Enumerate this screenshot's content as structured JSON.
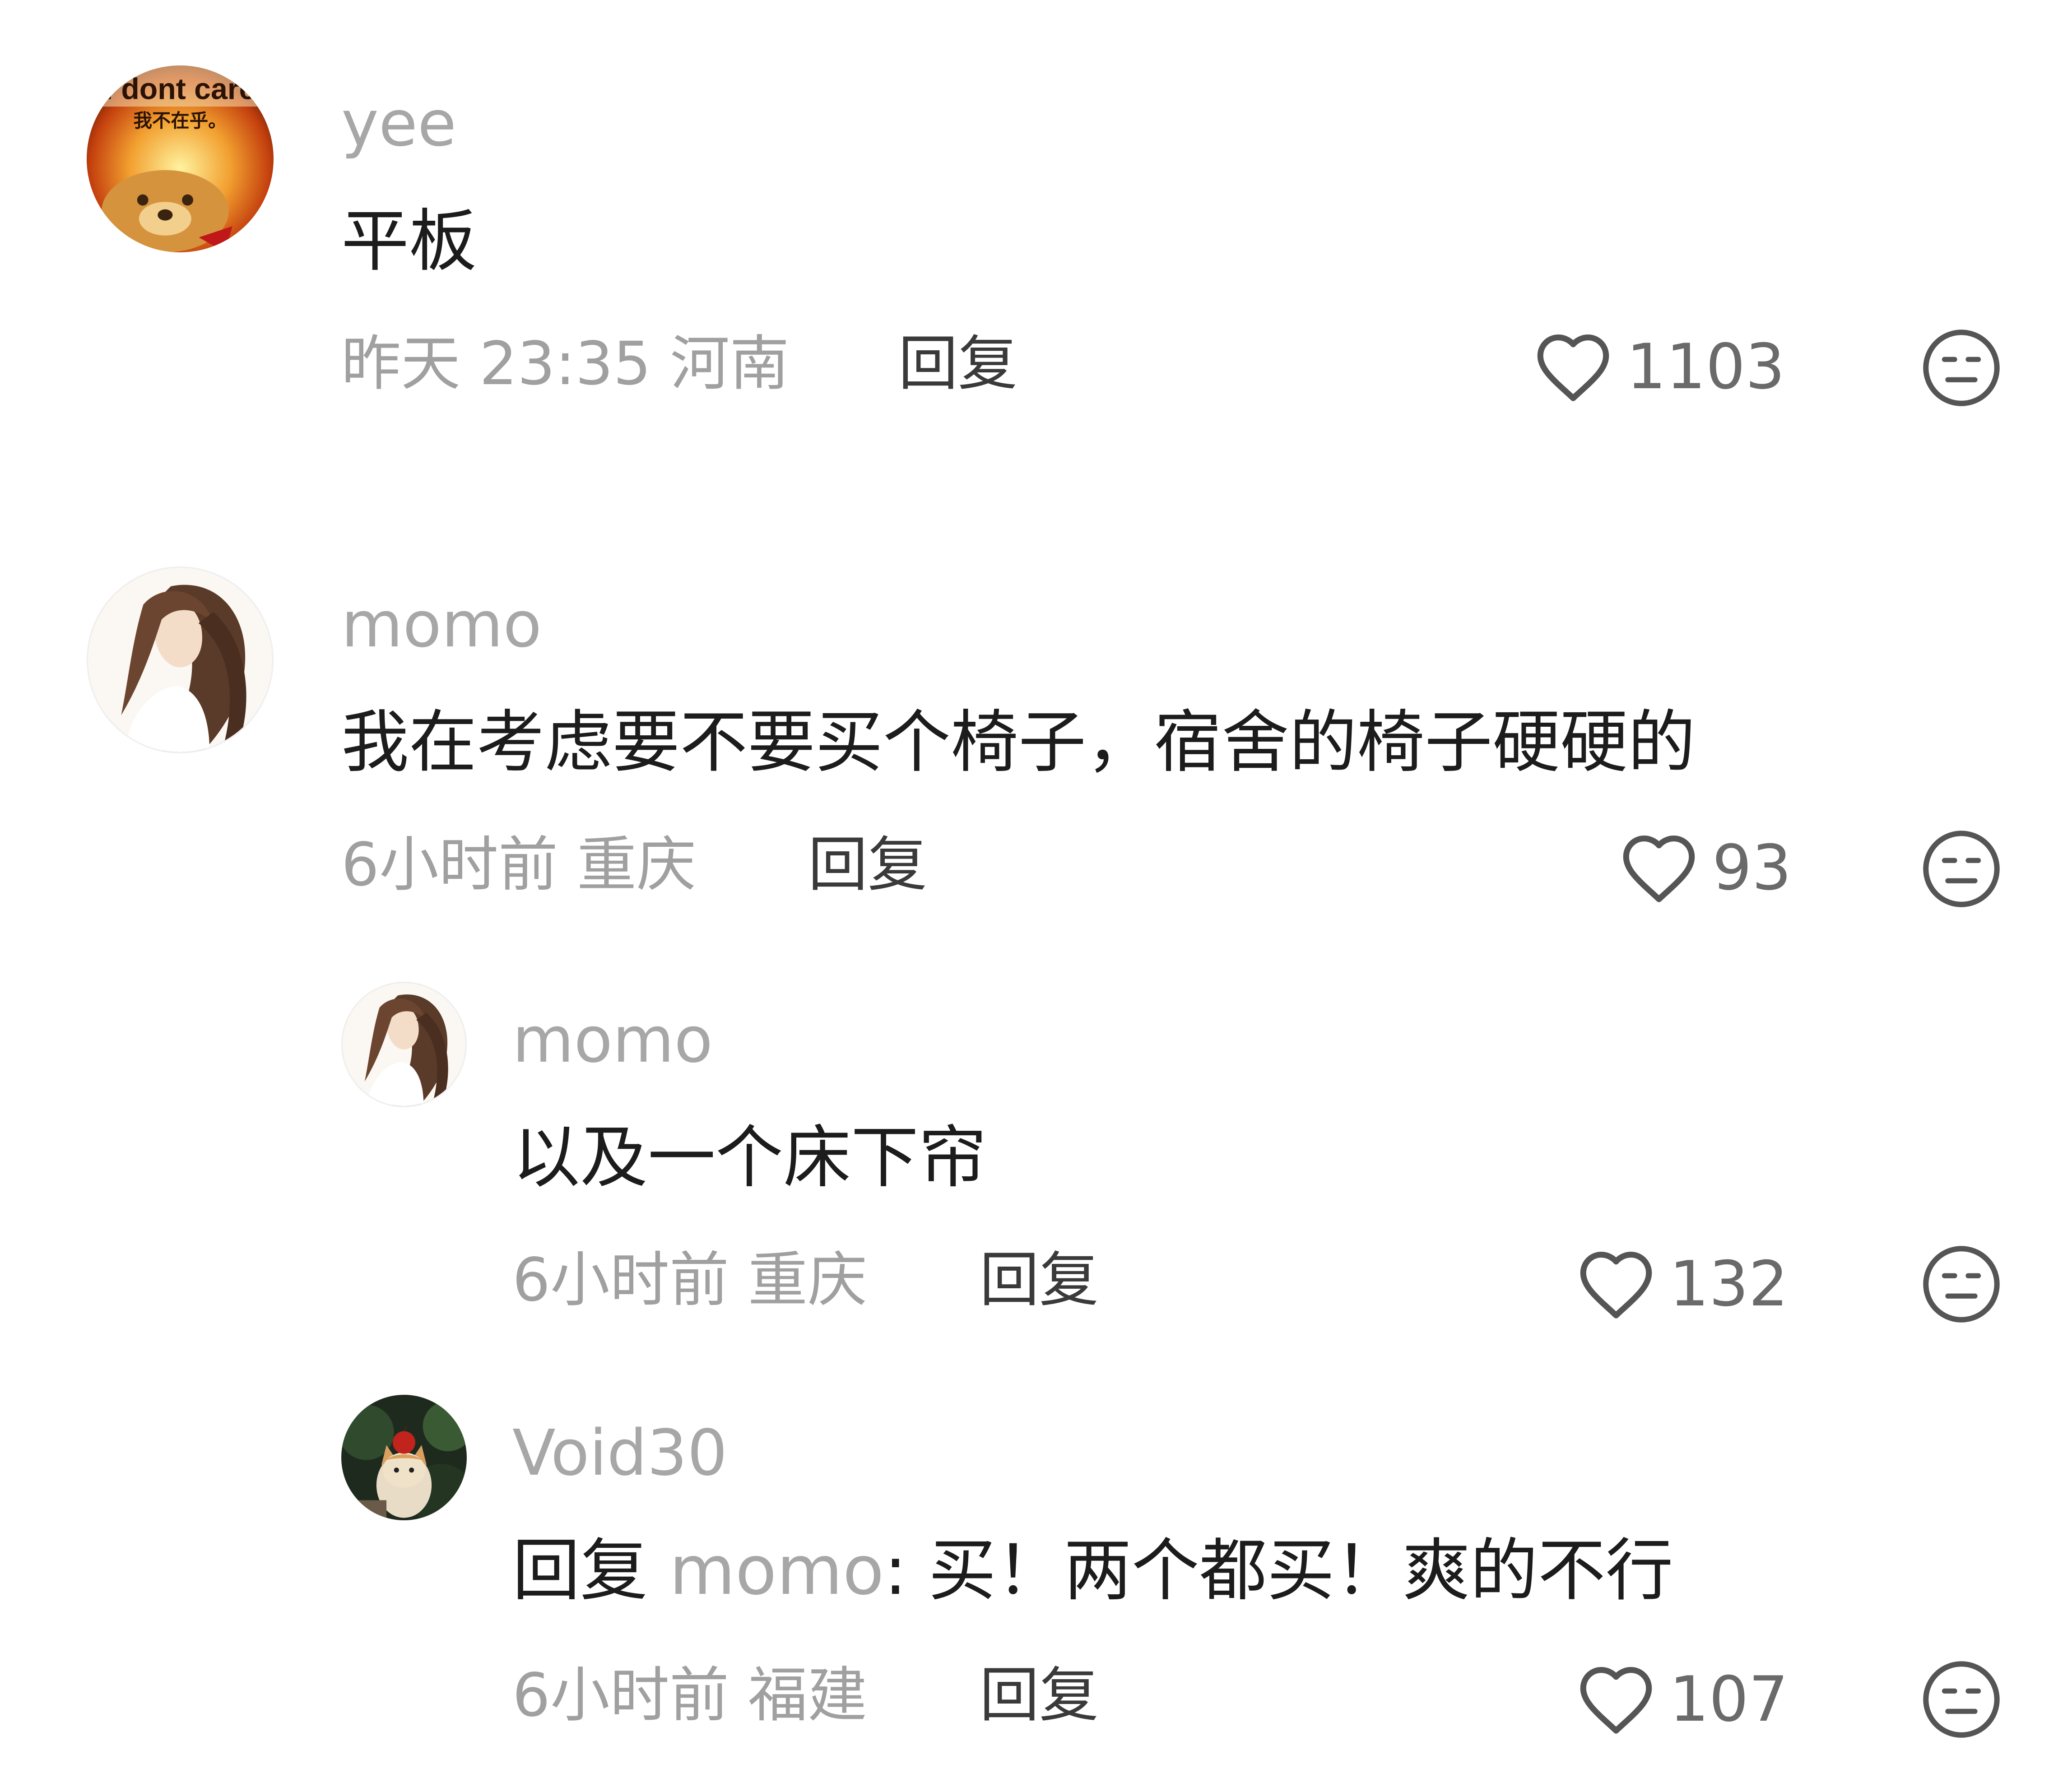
{
  "comments": [
    {
      "username": "yee",
      "text": "平板",
      "time": "昨天 23:35",
      "location": "河南",
      "reply_label": "回复",
      "likes": "1103",
      "avatar_text_en": "I dont care",
      "avatar_text_zh": "我不在乎。"
    },
    {
      "username": "momo",
      "text": "我在考虑要不要买个椅子，宿舍的椅子硬硬的",
      "time": "6小时前",
      "location": "重庆",
      "reply_label": "回复",
      "likes": "93"
    }
  ],
  "replies": [
    {
      "username": "momo",
      "text": "以及一个床下帘",
      "time": "6小时前",
      "location": "重庆",
      "reply_label": "回复",
      "likes": "132"
    },
    {
      "username": "Void30",
      "reply_prefix": "回复",
      "mention": "momo",
      "text": ": 买！两个都买！爽的不行",
      "time": "6小时前",
      "location": "福建",
      "reply_label": "回复",
      "likes": "107"
    }
  ],
  "colors": {
    "username": "#a7a7a7",
    "text": "#1c1c1c",
    "meta": "#a0a0a0",
    "icon": "#555555"
  },
  "icons": {
    "like": "heart-outline-icon",
    "dislike": "meh-face-icon"
  }
}
